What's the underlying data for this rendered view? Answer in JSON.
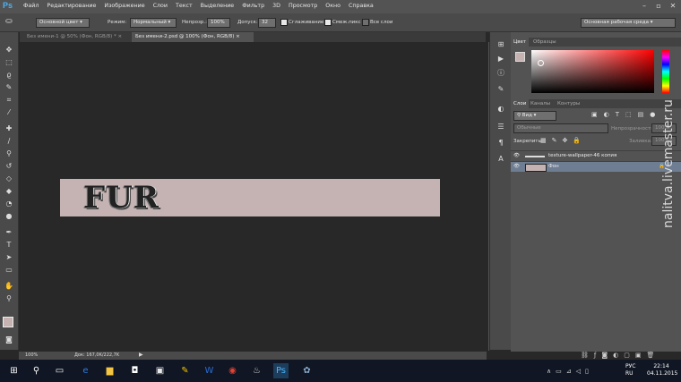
{
  "menu": {
    "logo": "Ps",
    "items": [
      "Файл",
      "Редактирование",
      "Изображение",
      "Слои",
      "Текст",
      "Выделение",
      "Фильтр",
      "3D",
      "Просмотр",
      "Окно",
      "Справка"
    ]
  },
  "options": {
    "source": "Основной цвет",
    "mode_label": "Режим:",
    "mode_value": "Нормальный",
    "opacity_label": "Непрозр.:",
    "opacity_value": "100%",
    "tolerance_label": "Допуск:",
    "tolerance_value": "32",
    "antialias_label": "Сглаживание",
    "contiguous_label": "Смеж.пикс",
    "all_layers_label": "Все слои",
    "workspace": "Основная рабочая среда"
  },
  "tabs": [
    {
      "label": "Без имени-1 @ 50% (Фон, RGB/8) *"
    },
    {
      "label": "Без имени-2.psd @ 100% (Фон, RGB/8)"
    }
  ],
  "canvas": {
    "doc_color": "#c4b3b2",
    "text": "FUR"
  },
  "status": {
    "zoom": "100%",
    "doc_info": "Док: 167,0K/222,7K"
  },
  "color_panel": {
    "tabs": [
      "Цвет",
      "Образцы"
    ],
    "fg": "#c6b3b1",
    "bg": "#1a1a1a"
  },
  "layers_panel": {
    "tabs": [
      "Слои",
      "Каналы",
      "Контуры"
    ],
    "filter": "Вид",
    "blend": "Обычные",
    "opacity_label": "Непрозрачность:",
    "opacity_value": "100%",
    "lock_label": "Закрепить:",
    "fill_label": "Заливка:",
    "fill_value": "100%",
    "layers": [
      {
        "name": "texture-wallpaper-46 копия",
        "selected": false
      },
      {
        "name": "Фон",
        "selected": true
      }
    ]
  },
  "watermark": "nalitva.livemaster.ru",
  "taskbar": {
    "lang_top": "РУС",
    "lang_bottom": "RU",
    "time": "22:14",
    "date": "04.11.2015"
  }
}
